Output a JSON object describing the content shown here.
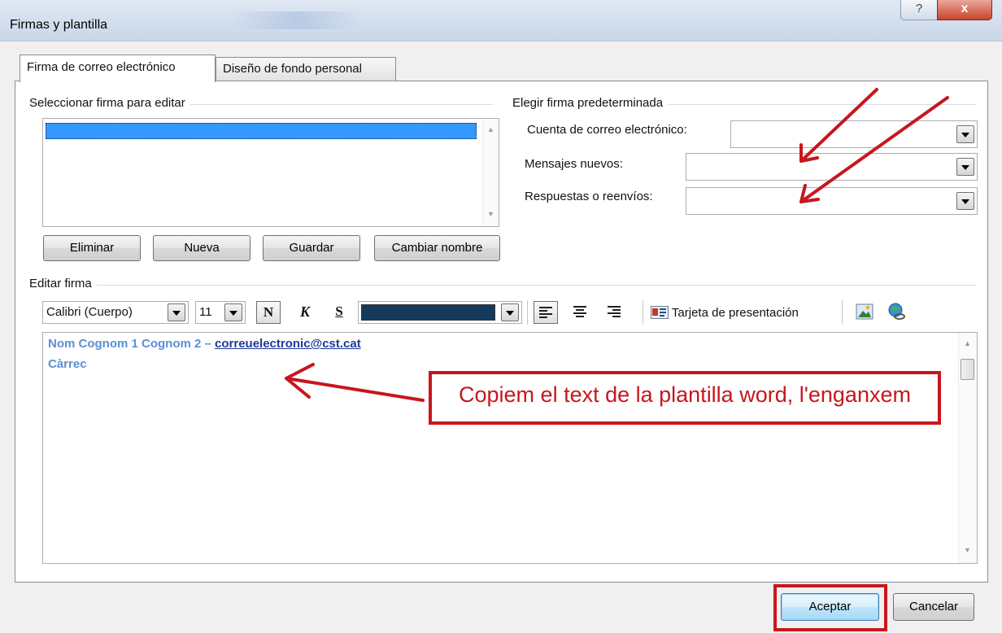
{
  "window": {
    "title": "Firmas y plantilla",
    "help_glyph": "?",
    "close_glyph": "x"
  },
  "tabs": [
    {
      "label": "Firma de correo electrónico",
      "selected": true
    },
    {
      "label": "Diseño de fondo personal",
      "selected": false
    }
  ],
  "select_signature": {
    "group_label": "Seleccionar firma para editar",
    "selected_item": ""
  },
  "signature_buttons": {
    "delete": "Eliminar",
    "new": "Nueva",
    "save": "Guardar",
    "rename": "Cambiar nombre"
  },
  "default_signature": {
    "group_label": "Elegir firma predeterminada",
    "account_label": "Cuenta de correo electrónico:",
    "account_value": "",
    "new_messages_label": "Mensajes nuevos:",
    "new_messages_value": "",
    "replies_label": "Respuestas o reenvíos:",
    "replies_value": ""
  },
  "edit_signature": {
    "group_label": "Editar firma",
    "font_name": "Calibri (Cuerpo)",
    "font_size": "11",
    "bold_glyph": "N",
    "italic_glyph": "K",
    "underline_glyph": "S",
    "font_color": "#163a5c",
    "business_card_label": "Tarjeta de presentación"
  },
  "editor_content": {
    "line1_name": "Nom Cognom 1 Cognom 2  – ",
    "line1_email": "correuelectronic@cst.cat",
    "line2": "Càrrec"
  },
  "annotation": {
    "text": "Copiem el text de la plantilla word, l'enganxem",
    "color": "#c8161d"
  },
  "dialog_buttons": {
    "ok": "Aceptar",
    "cancel": "Cancelar"
  }
}
